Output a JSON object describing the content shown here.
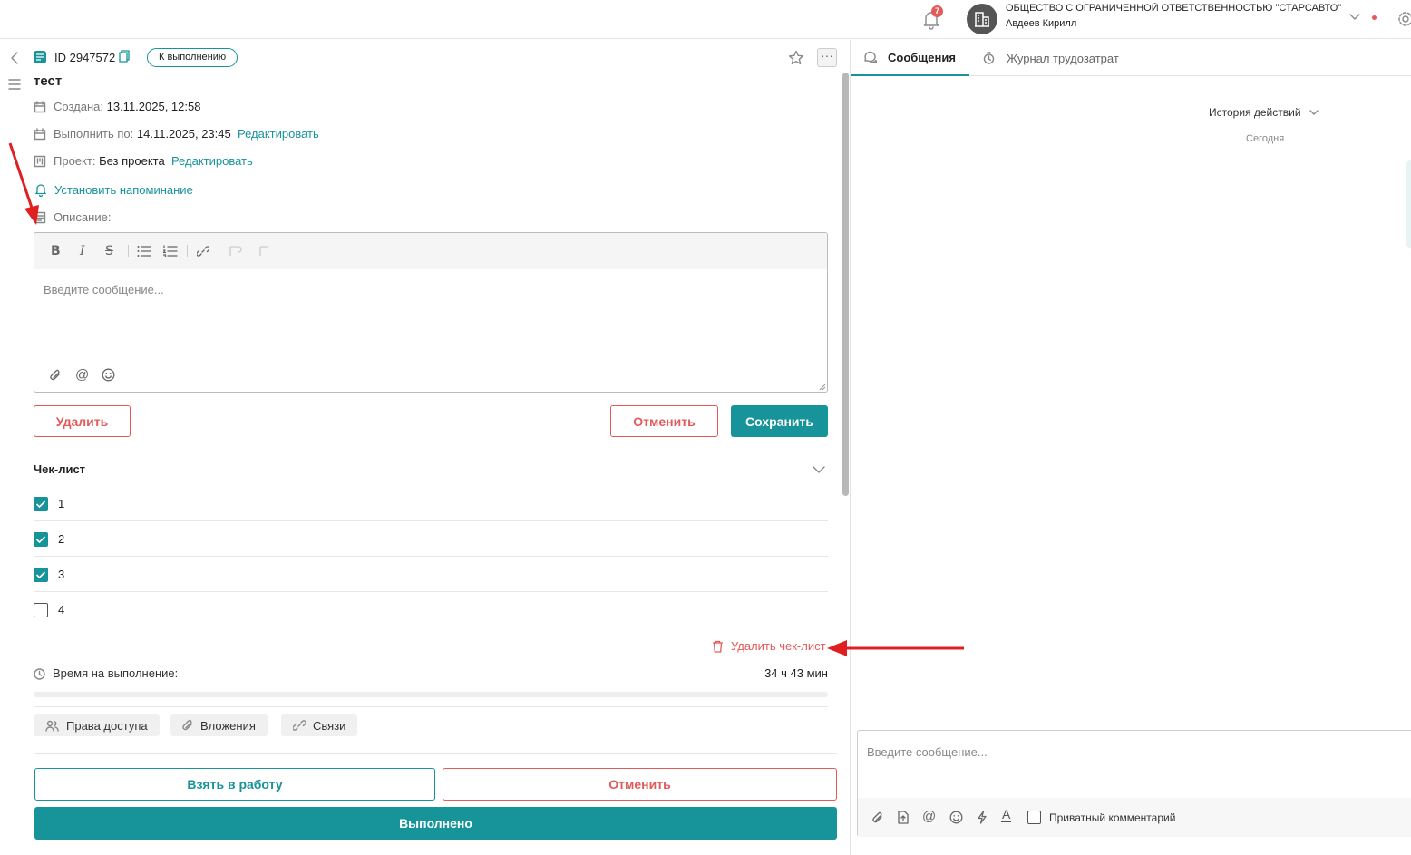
{
  "colors": {
    "accent": "#17939a",
    "danger": "#e35a5a",
    "annotation": "#e02020"
  },
  "header": {
    "notifications_count": "7",
    "org_name": "ОБЩЕСТВО С ОГРАНИЧЕННОЙ ОТВЕТСТВЕННОСТЬЮ \"СТАРСАВТО\"...",
    "user_name": "Авдеев Кирилл"
  },
  "task": {
    "id_label": "ID 2947572",
    "status": "К выполнению",
    "title": "тест",
    "created_label": "Создана:",
    "created_value": "13.11.2025, 12:58",
    "due_label": "Выполнить по:",
    "due_value": "14.11.2025, 23:45",
    "edit_label": "Редактировать",
    "project_label": "Проект:",
    "project_value": "Без проекта",
    "reminder_label": "Установить напоминание",
    "description_label": "Описание:",
    "editor_placeholder": "Введите сообщение...",
    "delete_label": "Удалить",
    "cancel_label": "Отменить",
    "save_label": "Сохранить"
  },
  "checklist": {
    "title": "Чек-лист",
    "items": [
      {
        "label": "1",
        "checked": true
      },
      {
        "label": "2",
        "checked": true
      },
      {
        "label": "3",
        "checked": true
      },
      {
        "label": "4",
        "checked": false
      }
    ],
    "delete_label": "Удалить чек-лист"
  },
  "time": {
    "label": "Время на выполнение:",
    "value": "34 ч 43 мин",
    "progress": 0
  },
  "chips": {
    "access": "Права доступа",
    "attachments": "Вложения",
    "links": "Связи"
  },
  "footer": {
    "take_label": "Взять в работу",
    "cancel_label": "Отменить",
    "done_label": "Выполнено"
  },
  "right_panel": {
    "tab_messages": "Сообщения",
    "tab_worklog": "Журнал трудозатрат",
    "history_label": "История действий",
    "today_label": "Сегодня",
    "composer_placeholder": "Введите сообщение...",
    "private_label": "Приватный комментарий"
  }
}
